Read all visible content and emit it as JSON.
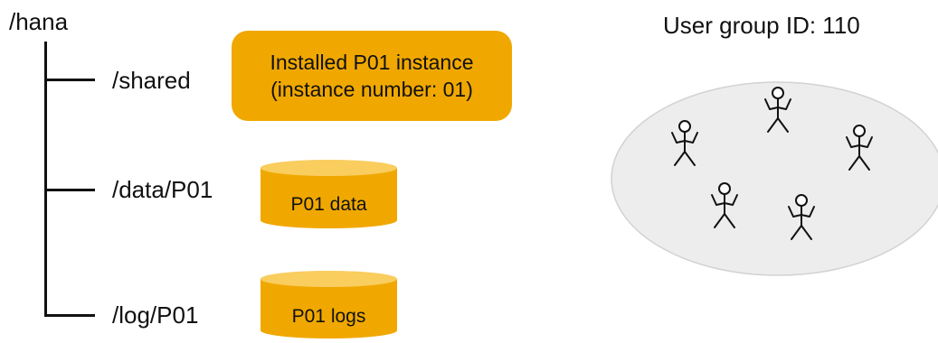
{
  "colors": {
    "accent_fill": "#F0A800",
    "cylinder_top": "#F9CD5E",
    "ellipse_fill": "#EDEDED",
    "ellipse_stroke": "#D2D2D2",
    "line": "#111111"
  },
  "tree": {
    "root": "/hana",
    "branches": [
      {
        "path": "/shared"
      },
      {
        "path": "/data/P01"
      },
      {
        "path": "/log/P01"
      }
    ]
  },
  "instance": {
    "line1": "Installed P01 instance",
    "line2": "(instance number: 01)"
  },
  "volumes": {
    "data": "P01 data",
    "logs": "P01 logs"
  },
  "user_group": {
    "title": "User group ID: 110",
    "user_count": 5,
    "user_icon": "stick-figure-icon"
  }
}
